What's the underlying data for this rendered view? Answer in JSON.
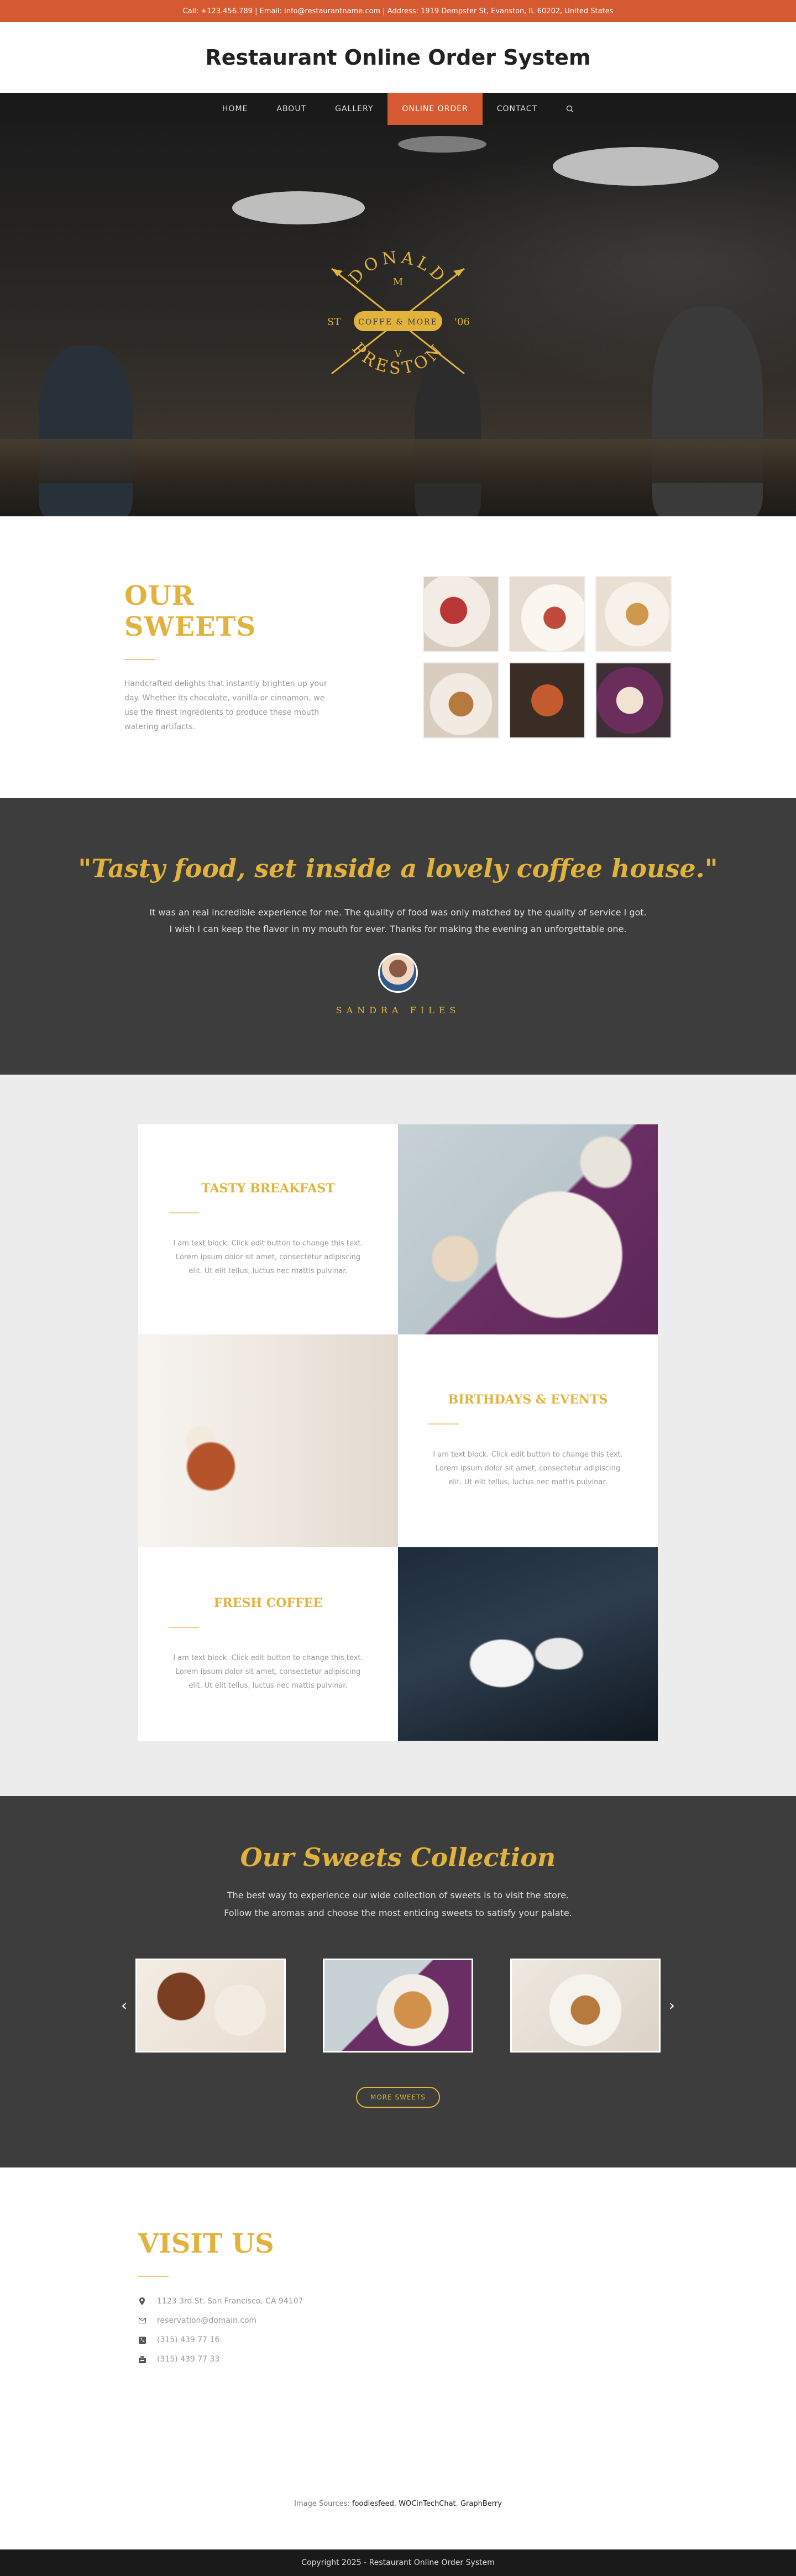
{
  "topbar": {
    "text": "Call: +123.456.789 | Email: info@restaurantname.com | Address: 1919 Dempster St, Evanston, IL 60202, United States"
  },
  "header": {
    "title": "Restaurant Online Order System"
  },
  "nav": {
    "items": [
      "HOME",
      "ABOUT",
      "GALLERY",
      "ONLINE ORDER",
      "CONTACT"
    ],
    "active_index": 3
  },
  "hero": {
    "logo": {
      "top": "DONALD",
      "m": "M",
      "left": "ST",
      "right": "'06",
      "ribbon": "COFFE & MORE",
      "v": "V",
      "bottom": "PRESTON"
    }
  },
  "sweets": {
    "title": "OUR SWEETS",
    "description": "Handcrafted delights that instantly brighten up your day. Whether its chocolate, vanilla or cinnamon, we use the finest ingredients to produce these mouth watering artifacts."
  },
  "testimonial": {
    "quote": "\"Tasty food, set inside a lovely coffee house.\"",
    "text": "It was an real incredible experience for me. The quality of food was only matched by the quality of service I got. I wish I can keep the flavor in my mouth for ever. Thanks for making the evening an unforgettable one.",
    "author": "SANDRA FILES"
  },
  "features": [
    {
      "title": "TASTY BREAKFAST",
      "text": "I am text block. Click edit button to change this text. Lorem ipsum dolor sit amet, consectetur adipiscing elit. Ut elit tellus, luctus nec mattis pulvinar."
    },
    {
      "title": "BIRTHDAYS & EVENTS",
      "text": "I am text block. Click edit button to change this text. Lorem ipsum dolor sit amet, consectetur adipiscing elit. Ut elit tellus, luctus nec mattis pulvinar."
    },
    {
      "title": "FRESH COFFEE",
      "text": "I am text block. Click edit button to change this text. Lorem ipsum dolor sit amet, consectetur adipiscing elit. Ut elit tellus, luctus nec mattis pulvinar."
    }
  ],
  "collection": {
    "title": "Our Sweets Collection",
    "line1": "The best way to experience our wide collection of sweets is to visit the store.",
    "line2": "Follow the aromas and choose the most enticing sweets to satisfy your palate.",
    "button": "MORE SWEETS"
  },
  "visit": {
    "title": "VISIT US",
    "items": [
      {
        "icon": "map-pin-icon",
        "text": "1123 3rd St. San Francisco, CA 94107"
      },
      {
        "icon": "envelope-icon",
        "text": "reservation@domain.com"
      },
      {
        "icon": "phone-icon",
        "text": "(315) 439 77 16"
      },
      {
        "icon": "fax-icon",
        "text": "(315) 439 77 33"
      }
    ]
  },
  "sources": {
    "label": "Image Sources:",
    "link1": "foodiesfeed",
    "sep1": ",",
    "link2": "WOCinTechChat",
    "sep2": ",",
    "link3": "GraphBerry"
  },
  "footer": {
    "text": "Copyright 2025 - Restaurant Online Order System"
  },
  "colors": {
    "accent": "#d65a31",
    "gold": "#e2b33c",
    "dark": "#3d3d3d",
    "nav": "#1a1a1a"
  }
}
